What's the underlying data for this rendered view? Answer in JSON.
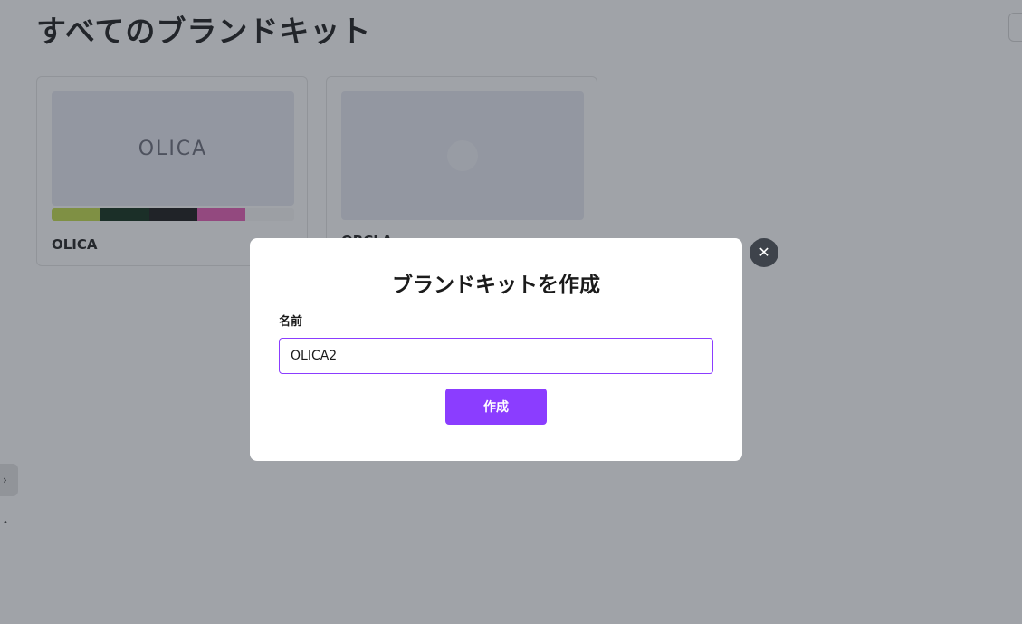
{
  "page": {
    "title": "すべてのブランドキット"
  },
  "side": {
    "tab_glyph": "›",
    "dot_glyph": "•"
  },
  "kits": [
    {
      "thumb_text": "OLICA",
      "name": "OLICA",
      "swatches": [
        "#c4dd49",
        "#0d2c17",
        "#0d2c17",
        "#161616",
        "#e85bb4",
        "#f7f7f7"
      ]
    },
    {
      "thumb_text": "",
      "name": "ORCLA"
    }
  ],
  "modal": {
    "title": "ブランドキットを作成",
    "name_label": "名前",
    "name_value": "OLICA2",
    "create_label": "作成",
    "close_glyph": "✕"
  },
  "colors": {
    "accent": "#8b3dff",
    "overlay": "rgba(45,52,62,0.45)"
  }
}
